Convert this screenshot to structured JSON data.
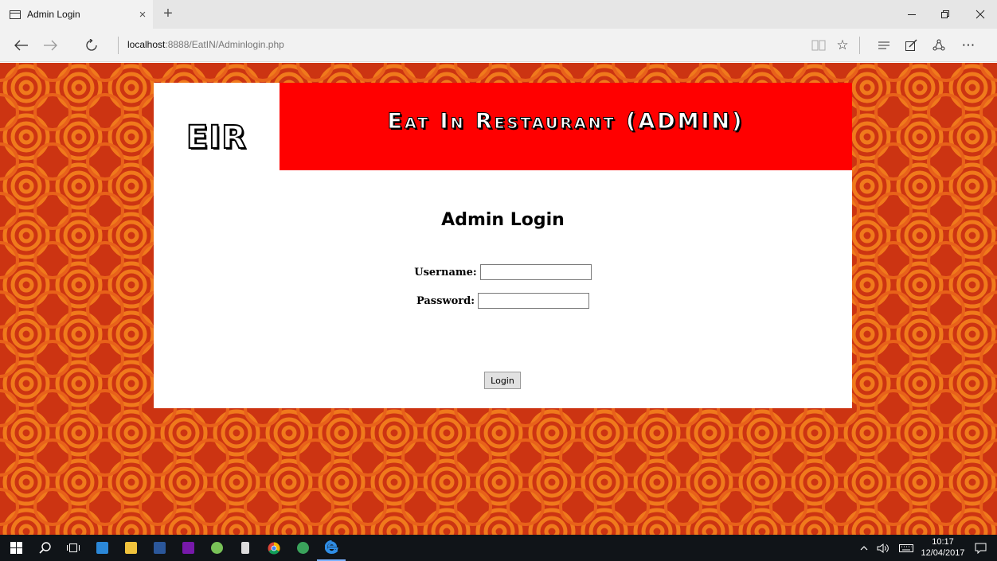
{
  "browser": {
    "tab_title": "Admin Login",
    "tab_close_label": "×",
    "new_tab_label": "+",
    "url_host": "localhost",
    "url_rest": ":8888/EatIN/Adminlogin.php"
  },
  "page": {
    "logo_text": "EIR",
    "banner_text": "Eat In Restaurant (ADMIN)",
    "form_title": "Admin Login",
    "username_label": "Username:",
    "username_value": "",
    "password_label": "Password:",
    "password_value": "",
    "login_button_label": "Login"
  },
  "taskbar": {
    "time": "10:17",
    "date": "12/04/2017"
  },
  "colors": {
    "banner": "#ff0000",
    "background": "#cc3412",
    "pattern_swirl": "#f07a1c",
    "taskbar": "#101418"
  },
  "icons": {
    "browser": [
      "tab-page-icon",
      "back-arrow-icon",
      "forward-arrow-icon",
      "refresh-icon",
      "reading-view-icon",
      "favorites-star-icon",
      "hub-icon",
      "web-note-icon",
      "share-icon",
      "more-icon"
    ],
    "taskbar": [
      "windows-start-icon",
      "search-icon",
      "task-view-icon",
      "sticky-notes-icon",
      "file-explorer-icon",
      "word-icon",
      "onenote-icon",
      "android-studio-icon",
      "device-icon",
      "chrome-icon",
      "app-icon",
      "edge-icon",
      "chevron-up-icon",
      "volume-icon",
      "keyboard-icon",
      "notifications-icon"
    ]
  }
}
